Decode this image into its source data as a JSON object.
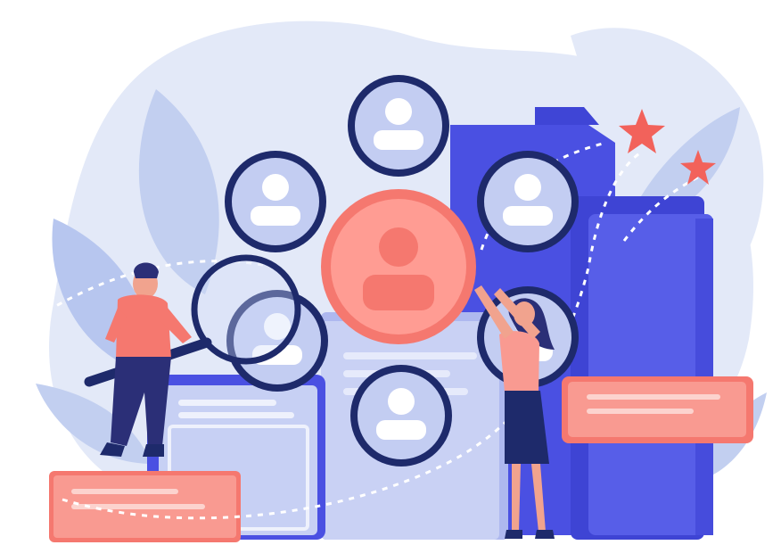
{
  "illustration": {
    "subject": "talent-search-candidate-selection",
    "icons": [
      "user-avatar-icon",
      "magnifier-icon",
      "star-icon",
      "folder-icon"
    ],
    "colors": {
      "background_blob": "#dfe6f7",
      "leaf": "#b9c8ef",
      "folder_dark": "#4a4fe0",
      "folder_light": "#8b93ee",
      "card_light": "#d7def7",
      "navy_ring": "#1e2a6b",
      "avatar_fill": "#c3cdf2",
      "avatar_figure": "#ffffff",
      "coral": "#f5786f",
      "coral_light": "#ffb3ab",
      "star": "#f2625b",
      "skin": "#f1a38e",
      "hair": "#2b2f77"
    }
  }
}
